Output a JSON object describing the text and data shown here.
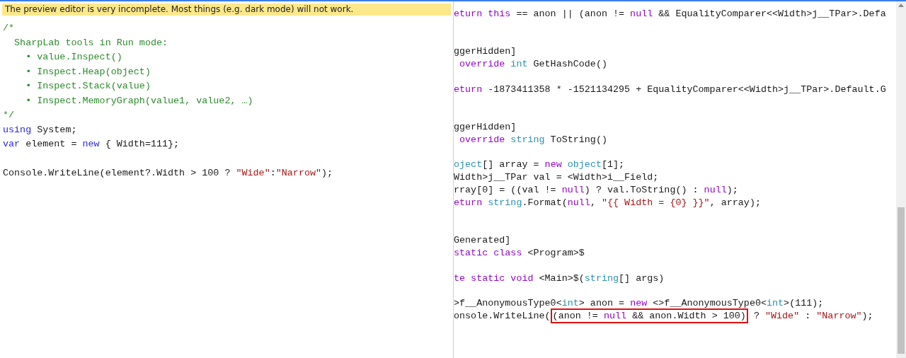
{
  "banner": {
    "text": "The preview editor is very incomplete. Most things (e.g. dark mode) will not work."
  },
  "source_pane": {
    "lines": [
      {
        "tokens": [
          {
            "kind": "comment",
            "text": "/*"
          }
        ]
      },
      {
        "tokens": [
          {
            "kind": "comment",
            "text": "  SharpLab tools in Run mode:"
          }
        ]
      },
      {
        "tokens": [
          {
            "kind": "comment",
            "text": "    • value.Inspect()"
          }
        ]
      },
      {
        "tokens": [
          {
            "kind": "comment",
            "text": "    • Inspect.Heap(object)"
          }
        ]
      },
      {
        "tokens": [
          {
            "kind": "comment",
            "text": "    • Inspect.Stack(value)"
          }
        ]
      },
      {
        "tokens": [
          {
            "kind": "comment",
            "text": "    • Inspect.MemoryGraph(value1, value2, …)"
          }
        ]
      },
      {
        "tokens": [
          {
            "kind": "comment",
            "text": "*/"
          }
        ]
      },
      {
        "tokens": [
          {
            "kind": "keyword",
            "text": "using"
          },
          {
            "kind": "plain",
            "text": " System;"
          }
        ]
      },
      {
        "tokens": [
          {
            "kind": "keyword",
            "text": "var"
          },
          {
            "kind": "plain",
            "text": " element = "
          },
          {
            "kind": "keyword",
            "text": "new"
          },
          {
            "kind": "plain",
            "text": " { Width=111};"
          }
        ]
      },
      {
        "kind": "blank"
      },
      {
        "tokens": [
          {
            "kind": "plain",
            "text": "Console.WriteLine(element?.Width > 100 ? "
          },
          {
            "kind": "string",
            "text": "\"Wide\""
          },
          {
            "kind": "plain",
            "text": ":"
          },
          {
            "kind": "string",
            "text": "\"Narrow\""
          },
          {
            "kind": "plain",
            "text": ");"
          }
        ]
      }
    ]
  },
  "output_pane": {
    "lines": [
      {
        "kind": "blank"
      },
      {
        "tokens": [
          {
            "kind": "control",
            "text": "eturn this"
          },
          {
            "kind": "plain",
            "text": " == anon || (anon != "
          },
          {
            "kind": "control",
            "text": "null"
          },
          {
            "kind": "plain",
            "text": " && EqualityComparer<<Width>j__TPar>.Defa"
          }
        ]
      },
      {
        "kind": "blank"
      },
      {
        "kind": "blank"
      },
      {
        "tokens": [
          {
            "kind": "plain",
            "text": "ggerHidden]"
          }
        ]
      },
      {
        "tokens": [
          {
            "kind": "control",
            "text": " override "
          },
          {
            "kind": "type",
            "text": "int"
          },
          {
            "kind": "plain",
            "text": " GetHashCode()"
          }
        ]
      },
      {
        "kind": "blank"
      },
      {
        "tokens": [
          {
            "kind": "control",
            "text": "eturn"
          },
          {
            "kind": "plain",
            "text": " -1873411358 * -1521134295 + EqualityComparer<<Width>j__TPar>.Default.G"
          }
        ]
      },
      {
        "kind": "blank"
      },
      {
        "kind": "blank"
      },
      {
        "tokens": [
          {
            "kind": "plain",
            "text": "ggerHidden]"
          }
        ]
      },
      {
        "tokens": [
          {
            "kind": "control",
            "text": " override "
          },
          {
            "kind": "type",
            "text": "string"
          },
          {
            "kind": "plain",
            "text": " ToString()"
          }
        ]
      },
      {
        "kind": "blank"
      },
      {
        "tokens": [
          {
            "kind": "type",
            "text": "oject"
          },
          {
            "kind": "plain",
            "text": "[] array = "
          },
          {
            "kind": "control",
            "text": "new "
          },
          {
            "kind": "type",
            "text": "object"
          },
          {
            "kind": "plain",
            "text": "[1];"
          }
        ]
      },
      {
        "tokens": [
          {
            "kind": "plain",
            "text": "Width>j__TPar val = <Width>i__Field;"
          }
        ]
      },
      {
        "tokens": [
          {
            "kind": "plain",
            "text": "rray[0] = ((val != "
          },
          {
            "kind": "control",
            "text": "null"
          },
          {
            "kind": "plain",
            "text": ") ? val.ToString() : "
          },
          {
            "kind": "control",
            "text": "null"
          },
          {
            "kind": "plain",
            "text": ");"
          }
        ]
      },
      {
        "tokens": [
          {
            "kind": "control",
            "text": "eturn "
          },
          {
            "kind": "type",
            "text": "string"
          },
          {
            "kind": "plain",
            "text": ".Format("
          },
          {
            "kind": "control",
            "text": "null"
          },
          {
            "kind": "plain",
            "text": ", "
          },
          {
            "kind": "string",
            "text": "\"{{ Width = {0} }}\""
          },
          {
            "kind": "plain",
            "text": ", array);"
          }
        ]
      },
      {
        "kind": "blank"
      },
      {
        "kind": "blank"
      },
      {
        "tokens": [
          {
            "kind": "plain",
            "text": "Generated]"
          }
        ]
      },
      {
        "tokens": [
          {
            "kind": "control",
            "text": "static class"
          },
          {
            "kind": "plain",
            "text": " <Program>$"
          }
        ]
      },
      {
        "kind": "blank"
      },
      {
        "tokens": [
          {
            "kind": "control",
            "text": "te static void"
          },
          {
            "kind": "plain",
            "text": " <Main>$("
          },
          {
            "kind": "type",
            "text": "string"
          },
          {
            "kind": "plain",
            "text": "[] args)"
          }
        ]
      },
      {
        "kind": "blank"
      },
      {
        "tokens": [
          {
            "kind": "plain",
            "text": ">f__AnonymousType0<"
          },
          {
            "kind": "type",
            "text": "int"
          },
          {
            "kind": "plain",
            "text": "> anon = "
          },
          {
            "kind": "control",
            "text": "new"
          },
          {
            "kind": "plain",
            "text": " <>f__AnonymousType0<"
          },
          {
            "kind": "type",
            "text": "int"
          },
          {
            "kind": "plain",
            "text": ">(111);"
          }
        ]
      },
      {
        "tokens": [
          {
            "kind": "plain",
            "text": "onsole.WriteLine("
          },
          {
            "kind": "highlight",
            "tokens": [
              {
                "kind": "plain",
                "text": "(anon != "
              },
              {
                "kind": "control",
                "text": "null"
              },
              {
                "kind": "plain",
                "text": " && anon.Width > 100)"
              }
            ]
          },
          {
            "kind": "plain",
            "text": " ? "
          },
          {
            "kind": "string",
            "text": "\"Wide\""
          },
          {
            "kind": "plain",
            "text": " : "
          },
          {
            "kind": "string",
            "text": "\"Narrow\""
          },
          {
            "kind": "plain",
            "text": ");"
          }
        ]
      }
    ]
  }
}
